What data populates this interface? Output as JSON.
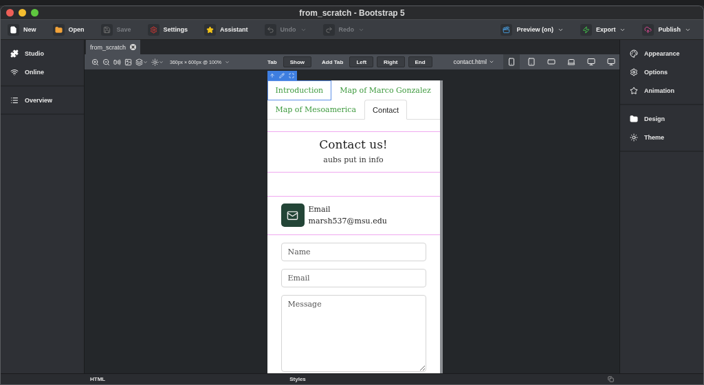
{
  "window": {
    "title": "from_scratch - Bootstrap 5"
  },
  "toolbar": {
    "left": [
      {
        "label": "New",
        "disabled": false,
        "dropdown": false
      },
      {
        "label": "Open",
        "disabled": false,
        "dropdown": false
      },
      {
        "label": "Save",
        "disabled": true,
        "dropdown": false
      },
      {
        "label": "Settings",
        "disabled": false,
        "dropdown": false
      },
      {
        "label": "Assistant",
        "disabled": false,
        "dropdown": false
      },
      {
        "label": "Undo",
        "disabled": true,
        "dropdown": true
      },
      {
        "label": "Redo",
        "disabled": true,
        "dropdown": true
      }
    ],
    "right": [
      {
        "label": "Preview (on)",
        "disabled": false,
        "dropdown": true
      },
      {
        "label": "Export",
        "disabled": false,
        "dropdown": true
      },
      {
        "label": "Publish",
        "disabled": false,
        "dropdown": true
      }
    ]
  },
  "sidebar": {
    "groups": [
      [
        {
          "label": "Studio"
        },
        {
          "label": "Online"
        }
      ],
      [
        {
          "label": "Overview"
        }
      ]
    ]
  },
  "document_tab": {
    "label": "from_scratch"
  },
  "canvas_toolbar": {
    "viewport": "360px × 600px @ 100%",
    "tab_label": "Tab",
    "show_button": "Show",
    "add_tab_label": "Add Tab",
    "add_buttons": [
      "Left",
      "Right",
      "End"
    ],
    "page": "contact.html",
    "devices": [
      {
        "selected": true
      },
      {
        "selected": false
      },
      {
        "selected": false
      },
      {
        "selected": false
      },
      {
        "selected": false
      },
      {
        "selected": false
      }
    ]
  },
  "preview": {
    "nav_tabs": [
      {
        "label": "Introduction",
        "selected": false,
        "highlighted": true
      },
      {
        "label": "Map of Marco Gonzalez",
        "selected": false,
        "highlighted": false
      },
      {
        "label": "Map of Mesoamerica",
        "selected": false,
        "highlighted": false
      },
      {
        "label": "Contact",
        "selected": true,
        "highlighted": false
      }
    ],
    "heading": "Contact us!",
    "subheading": "aubs put in info",
    "contact": {
      "label": "Email",
      "value": "marsh537@msu.edu"
    },
    "form": [
      {
        "kind": "input",
        "placeholder": "Name"
      },
      {
        "kind": "input",
        "placeholder": "Email"
      },
      {
        "kind": "textarea",
        "placeholder": "Message"
      }
    ]
  },
  "right_panel": {
    "groups": [
      [
        {
          "label": "Appearance"
        },
        {
          "label": "Options"
        },
        {
          "label": "Animation"
        }
      ],
      [
        {
          "label": "Design"
        },
        {
          "label": "Theme"
        }
      ]
    ]
  },
  "bottom_bar": {
    "left": "HTML",
    "center": "Styles"
  }
}
